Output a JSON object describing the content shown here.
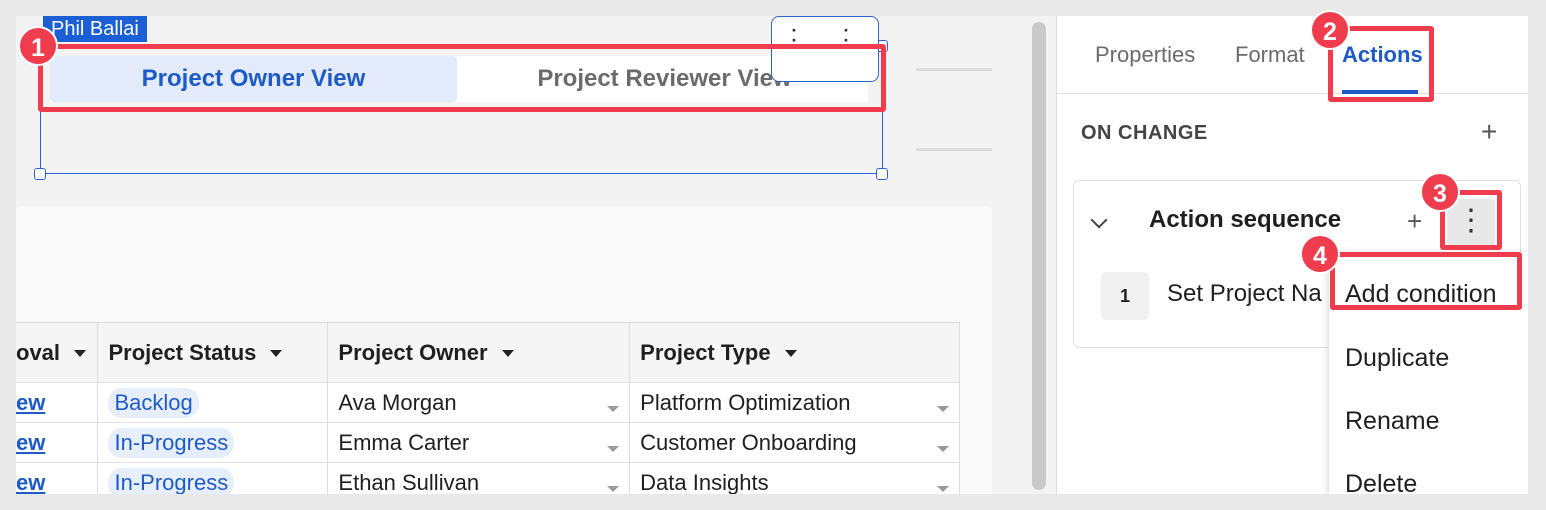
{
  "canvas": {
    "user_tag": "Phil Ballai",
    "segmented": {
      "options": [
        "Project Owner View",
        "Project Reviewer View"
      ]
    },
    "drag_dots": "⠅"
  },
  "table": {
    "columns": [
      "oval",
      "Project Status",
      "Project Owner",
      "Project Type"
    ],
    "rows": [
      {
        "link": "ew",
        "status": "Backlog",
        "owner": "Ava Morgan",
        "type": "Platform Optimization"
      },
      {
        "link": "ew",
        "status": "In-Progress",
        "owner": "Emma Carter",
        "type": "Customer Onboarding"
      },
      {
        "link": "ew",
        "status": "In-Progress",
        "owner": "Ethan Sullivan",
        "type": "Data Insights"
      }
    ]
  },
  "panel": {
    "tabs": [
      "Properties",
      "Format",
      "Actions"
    ],
    "active_tab": "Actions",
    "section_title": "ON CHANGE",
    "plus": "+",
    "sequence": {
      "title": "Action sequence",
      "kebab": "⋮",
      "step_number": "1",
      "step_label": "Set Project Na"
    },
    "menu": [
      "Add condition",
      "Duplicate",
      "Rename",
      "Delete"
    ]
  },
  "annotations": {
    "badges": [
      "1",
      "2",
      "3",
      "4"
    ],
    "color": "#ef3d4e"
  },
  "colors": {
    "accent": "#1e5bc6",
    "selection": "#2d63d0"
  }
}
